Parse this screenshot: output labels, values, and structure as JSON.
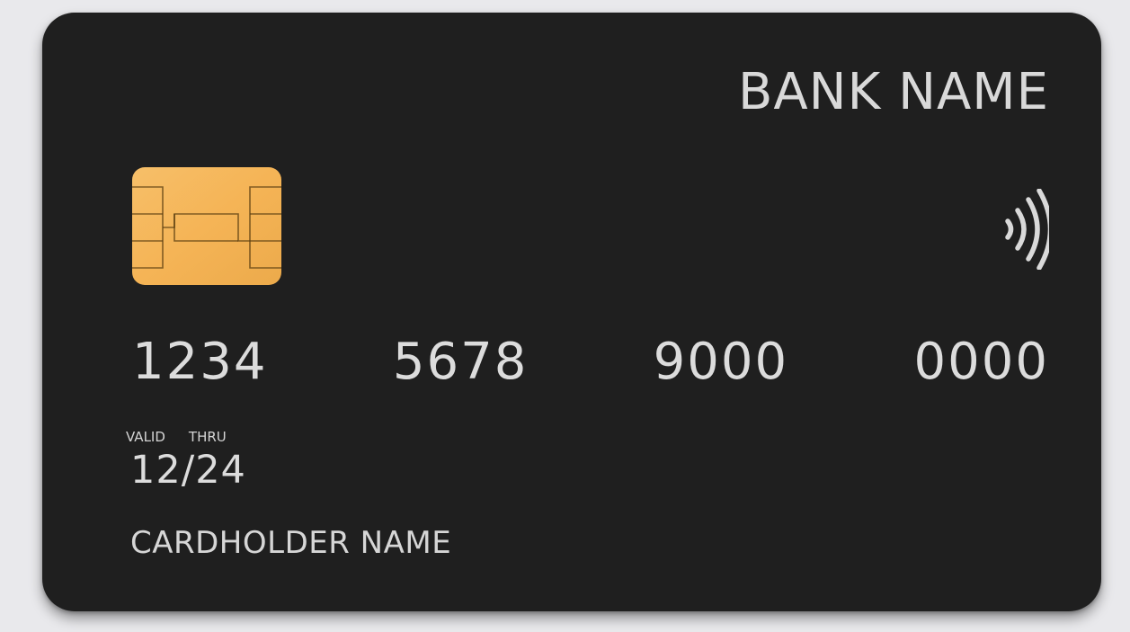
{
  "card": {
    "bank_name": "BANK NAME",
    "number_groups": [
      "1234",
      "5678",
      "9000",
      "0000"
    ],
    "valid_label": "VALID",
    "thru_label": "THRU",
    "expiry": "12/24",
    "cardholder": "CARDHOLDER NAME",
    "colors": {
      "background": "#e9e9ec",
      "card": "#1f1f1f",
      "text": "#dcdcdc",
      "chip": "#f5b55a"
    },
    "icons": [
      "chip-icon",
      "contactless-icon"
    ]
  }
}
